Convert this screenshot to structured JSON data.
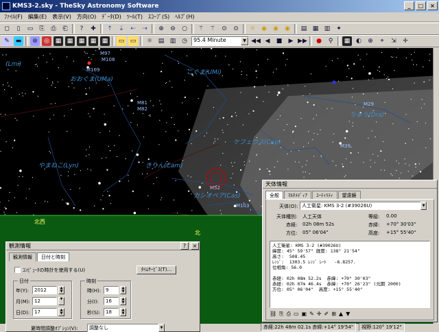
{
  "window": {
    "title": "KMS3-2.sky - TheSky Astronomy Software",
    "buttons": [
      "_",
      "□",
      "×"
    ]
  },
  "menu": [
    "ﾌｧｲﾙ(F)",
    "編集(E)",
    "表示(V)",
    "方向(O)",
    "ﾃﾞｰﾀ(D)",
    "ﾂｰﾙ(T)",
    "ｽｺｰﾌﾟ(S)",
    "ﾍﾙﾌﾟ(H)"
  ],
  "toolbar1": [
    "◻",
    "▯",
    "▭",
    "⎘",
    "⎙",
    "⎗",
    "?",
    "✚",
    "⇡",
    "⇣",
    "⇠",
    "⇢",
    "⊕",
    "⊖",
    "○",
    "⚚",
    "⚚",
    "⊙",
    "⊙",
    "☼",
    "◉",
    "◉",
    "◉",
    "▤",
    "▦",
    "▥",
    "✦"
  ],
  "toolbar2": {
    "combo_value": "95.4 Minute",
    "playback": [
      "◀◀",
      "◀",
      "■",
      "▶",
      "▶▶"
    ]
  },
  "sky": {
    "constellations": [
      {
        "name": "(Lmi)"
      },
      {
        "name": "おおぐま(UMa)"
      },
      {
        "name": "こぐま(UMi)"
      },
      {
        "name": "りゅう(Dra)"
      },
      {
        "name": "ケフェウス(Cep)"
      },
      {
        "name": "やまねこ(Lyn)"
      },
      {
        "name": "きりん(Cam)"
      },
      {
        "name": "カシオペア(Cas)"
      }
    ],
    "messier": [
      "M97",
      "M108",
      "M109",
      "M81",
      "M82",
      "M29",
      "M39",
      "M52",
      "M103"
    ],
    "directions": [
      "北西",
      "北"
    ]
  },
  "objinfo": {
    "title": "天体情報",
    "tabs": [
      "全般",
      "ﾏﾙﾁﾒﾃﾞｨｱ",
      "ﾕｰﾃｨﾘﾃｨ",
      "望遠鏡"
    ],
    "name_label": "天体(O):",
    "name_value": "人工衛星: KMS 3-2 (#39026U)",
    "type_label": "天体種別:",
    "type_value": "人工天体",
    "mag_label": "等級:",
    "mag_value": "0.00",
    "ra_label": "赤経:",
    "ra_value": "02h 08m 52s",
    "dec_label": "赤緯:",
    "dec_value": "+70° 30'03\"",
    "az_label": "方位:",
    "az_value": "05° 06'04\"",
    "alt_label": "高度:",
    "alt_value": "+15° 55'40\"",
    "details": "人工衛星: KMS 3-2 (#39026U)\n緯度: 45° 59'57\" 経度: 138° 21'54\"\n高さ:  508.45\nﾚﾝｼﾞ:  1303.5 ﾚﾝｼﾞ ﾚｰﾄ   -6.8257.\n位相角: 56.0\n\n赤経: 02h 08m 52.2s  赤緯: +70° 30'03\"\n赤経: 02h 07m 46.4s  赤緯: +70° 26'23\" (元期 2000)\n方位: 05° 06'04\"  高度: +15° 55'40\""
  },
  "obsinfo": {
    "title": "観測情報",
    "help": "?",
    "close": "×",
    "tabs": [
      "観測情報",
      "日付と時刻"
    ],
    "use_pc_clock": "ｺﾝﾋﾟｭｰﾀの時計を使用する(U)",
    "time_service": "ﾀｲﾑｻｰﾋﾞｽ(T)...",
    "date_group": "日付",
    "time_group": "時刻",
    "year_label": "年(Y):",
    "year": "2012",
    "month_label": "月(M):",
    "month": "12",
    "day_label": "日(D):",
    "day": "17",
    "hour_label": "時(H):",
    "hour": "9",
    "min_label": "分(I):",
    "min": "16",
    "sec_label": "秒(S):",
    "sec": "18",
    "dst_label": "夏時間調整ｵﾌﾟｼｮﾝ(V):",
    "dst_value": "調整なし"
  },
  "status": {
    "radec": "赤経:22h 48m 02.1s  赤緯:+14° 19'54\"",
    "fov": "視野:120° 19'12\""
  },
  "colors": {
    "sky": "#000000",
    "ground": "#0b5a12",
    "constellation_label": "#3d8fd0"
  }
}
